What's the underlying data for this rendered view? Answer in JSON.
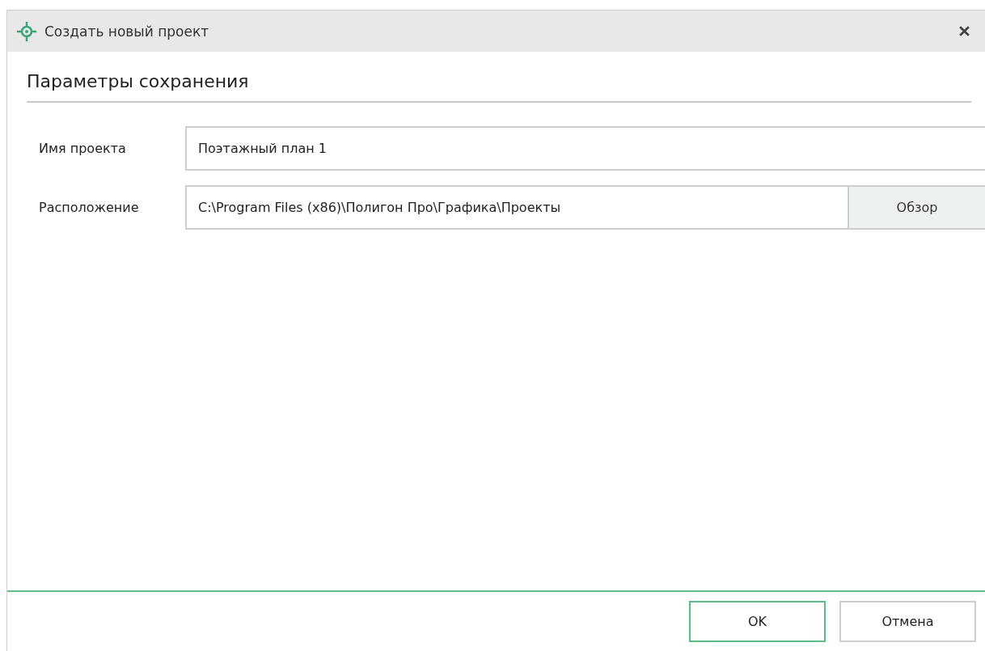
{
  "window": {
    "title": "Создать новый проект"
  },
  "section": {
    "title": "Параметры сохранения"
  },
  "fields": [
    {
      "label": "Имя проекта",
      "value": "Поэтажный план 1"
    },
    {
      "label": "Расположение",
      "value": "C:\\Program Files (x86)\\Полигон Про\\Графика\\Проекты",
      "button": "Обзор"
    }
  ],
  "buttons": [
    {
      "label": "OK",
      "default": true
    },
    {
      "label": "Отмена",
      "default": false
    }
  ]
}
